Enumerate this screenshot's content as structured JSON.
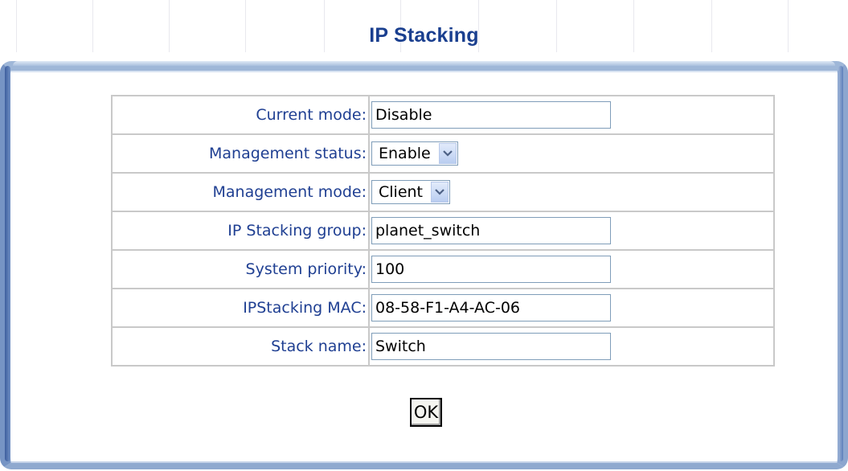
{
  "page": {
    "title": "IP Stacking"
  },
  "form": {
    "rows": [
      {
        "label": "Current mode:",
        "type": "text",
        "value": "Disable"
      },
      {
        "label": "Management status:",
        "type": "select",
        "value": "Enable"
      },
      {
        "label": "Management mode:",
        "type": "select",
        "value": "Client"
      },
      {
        "label": "IP Stacking group:",
        "type": "text",
        "value": "planet_switch"
      },
      {
        "label": "System priority:",
        "type": "text",
        "value": "100"
      },
      {
        "label": "IPStacking MAC:",
        "type": "text",
        "value": "08-58-F1-A4-AC-06"
      },
      {
        "label": "Stack name:",
        "type": "text",
        "value": "Switch"
      }
    ],
    "ok_label": "OK"
  },
  "icons": {
    "dropdown": "chevron-down-icon"
  },
  "colors": {
    "title": "#1a3f8f",
    "label": "#1f3f92",
    "frame": "#7694c4"
  }
}
